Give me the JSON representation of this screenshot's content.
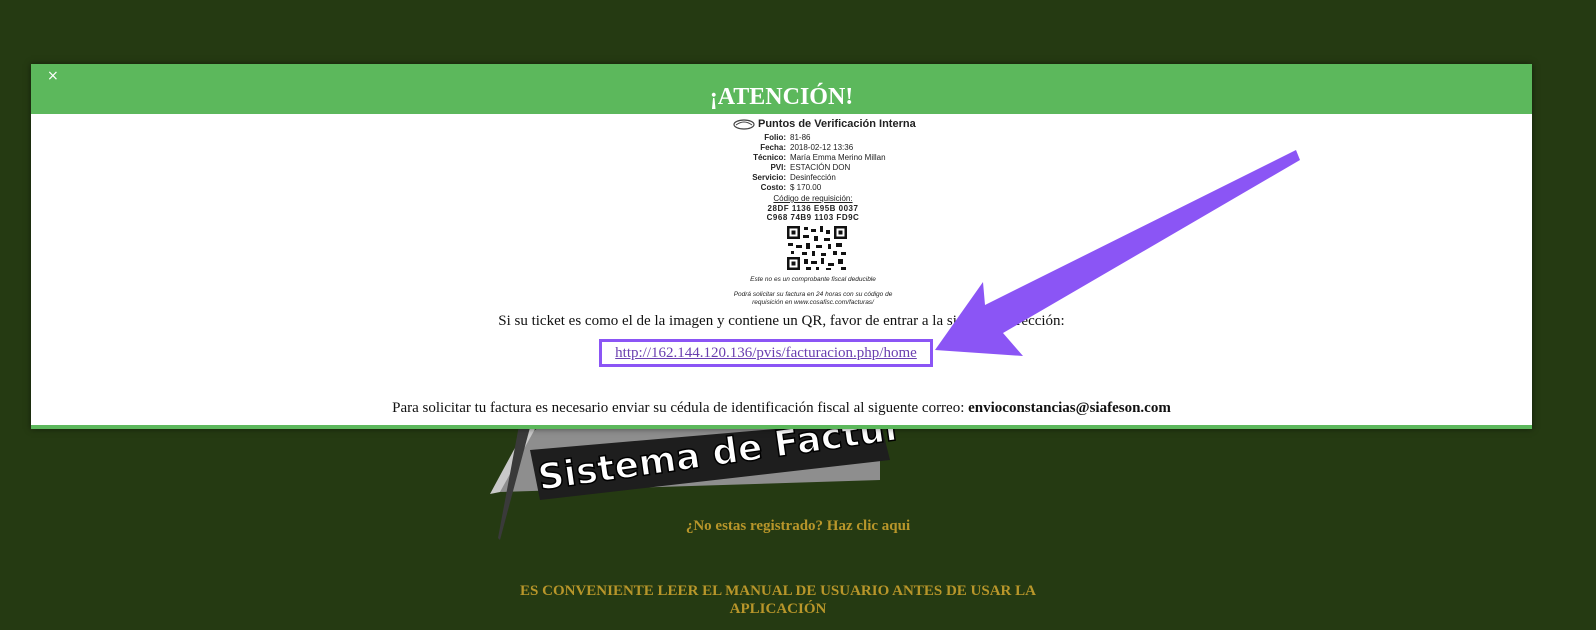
{
  "background": {
    "logo_text": "Sistema de Facturación PVI",
    "register_link": "¿No estas registrado? Haz clic aqui",
    "manual_notice": "ES CONVENIENTE LEER EL MANUAL DE USUARIO ANTES DE USAR LA APLICACIÓN"
  },
  "modal": {
    "close_label": "×",
    "title": "¡ATENCIÓN!",
    "instruction": "Si su ticket es como el de la imagen y contiene un QR, favor de entrar a la siguiente dirección:",
    "link": "http://162.144.120.136/pvis/facturacion.php/home",
    "request_text": "Para solicitar tu factura es necesario enviar su cédula de identificación fiscal al siguente correo:",
    "email": "envioconstancias@siafeson.com"
  },
  "ticket": {
    "header": "Puntos de Verificación Interna",
    "rows": [
      {
        "label": "Folio:",
        "value": "81-86"
      },
      {
        "label": "Fecha:",
        "value": "2018-02-12 13:36"
      },
      {
        "label": "Técnico:",
        "value": "María Emma Merino Millan"
      },
      {
        "label": "PVI:",
        "value": "ESTACIÓN DON"
      },
      {
        "label": "Servicio:",
        "value": "Desinfección"
      },
      {
        "label": "Costo:",
        "value": "$ 170.00"
      }
    ],
    "code_title": "Código de requisición:",
    "code_line1": "28DF   1136   E95B   0037",
    "code_line2": "C968   74B9   1103   FD9C",
    "footer1": "Este no es un comprobante fiscal deducible",
    "footer2": "Podrá solicitar su factura en 24 horas con su código de",
    "footer3": "requisición en www.cosafisc.com/facturas/"
  },
  "colors": {
    "page_bg": "#253a12",
    "header_green": "#5cb85c",
    "highlight_purple": "#8b55f5",
    "gold_text": "#b8962a"
  }
}
